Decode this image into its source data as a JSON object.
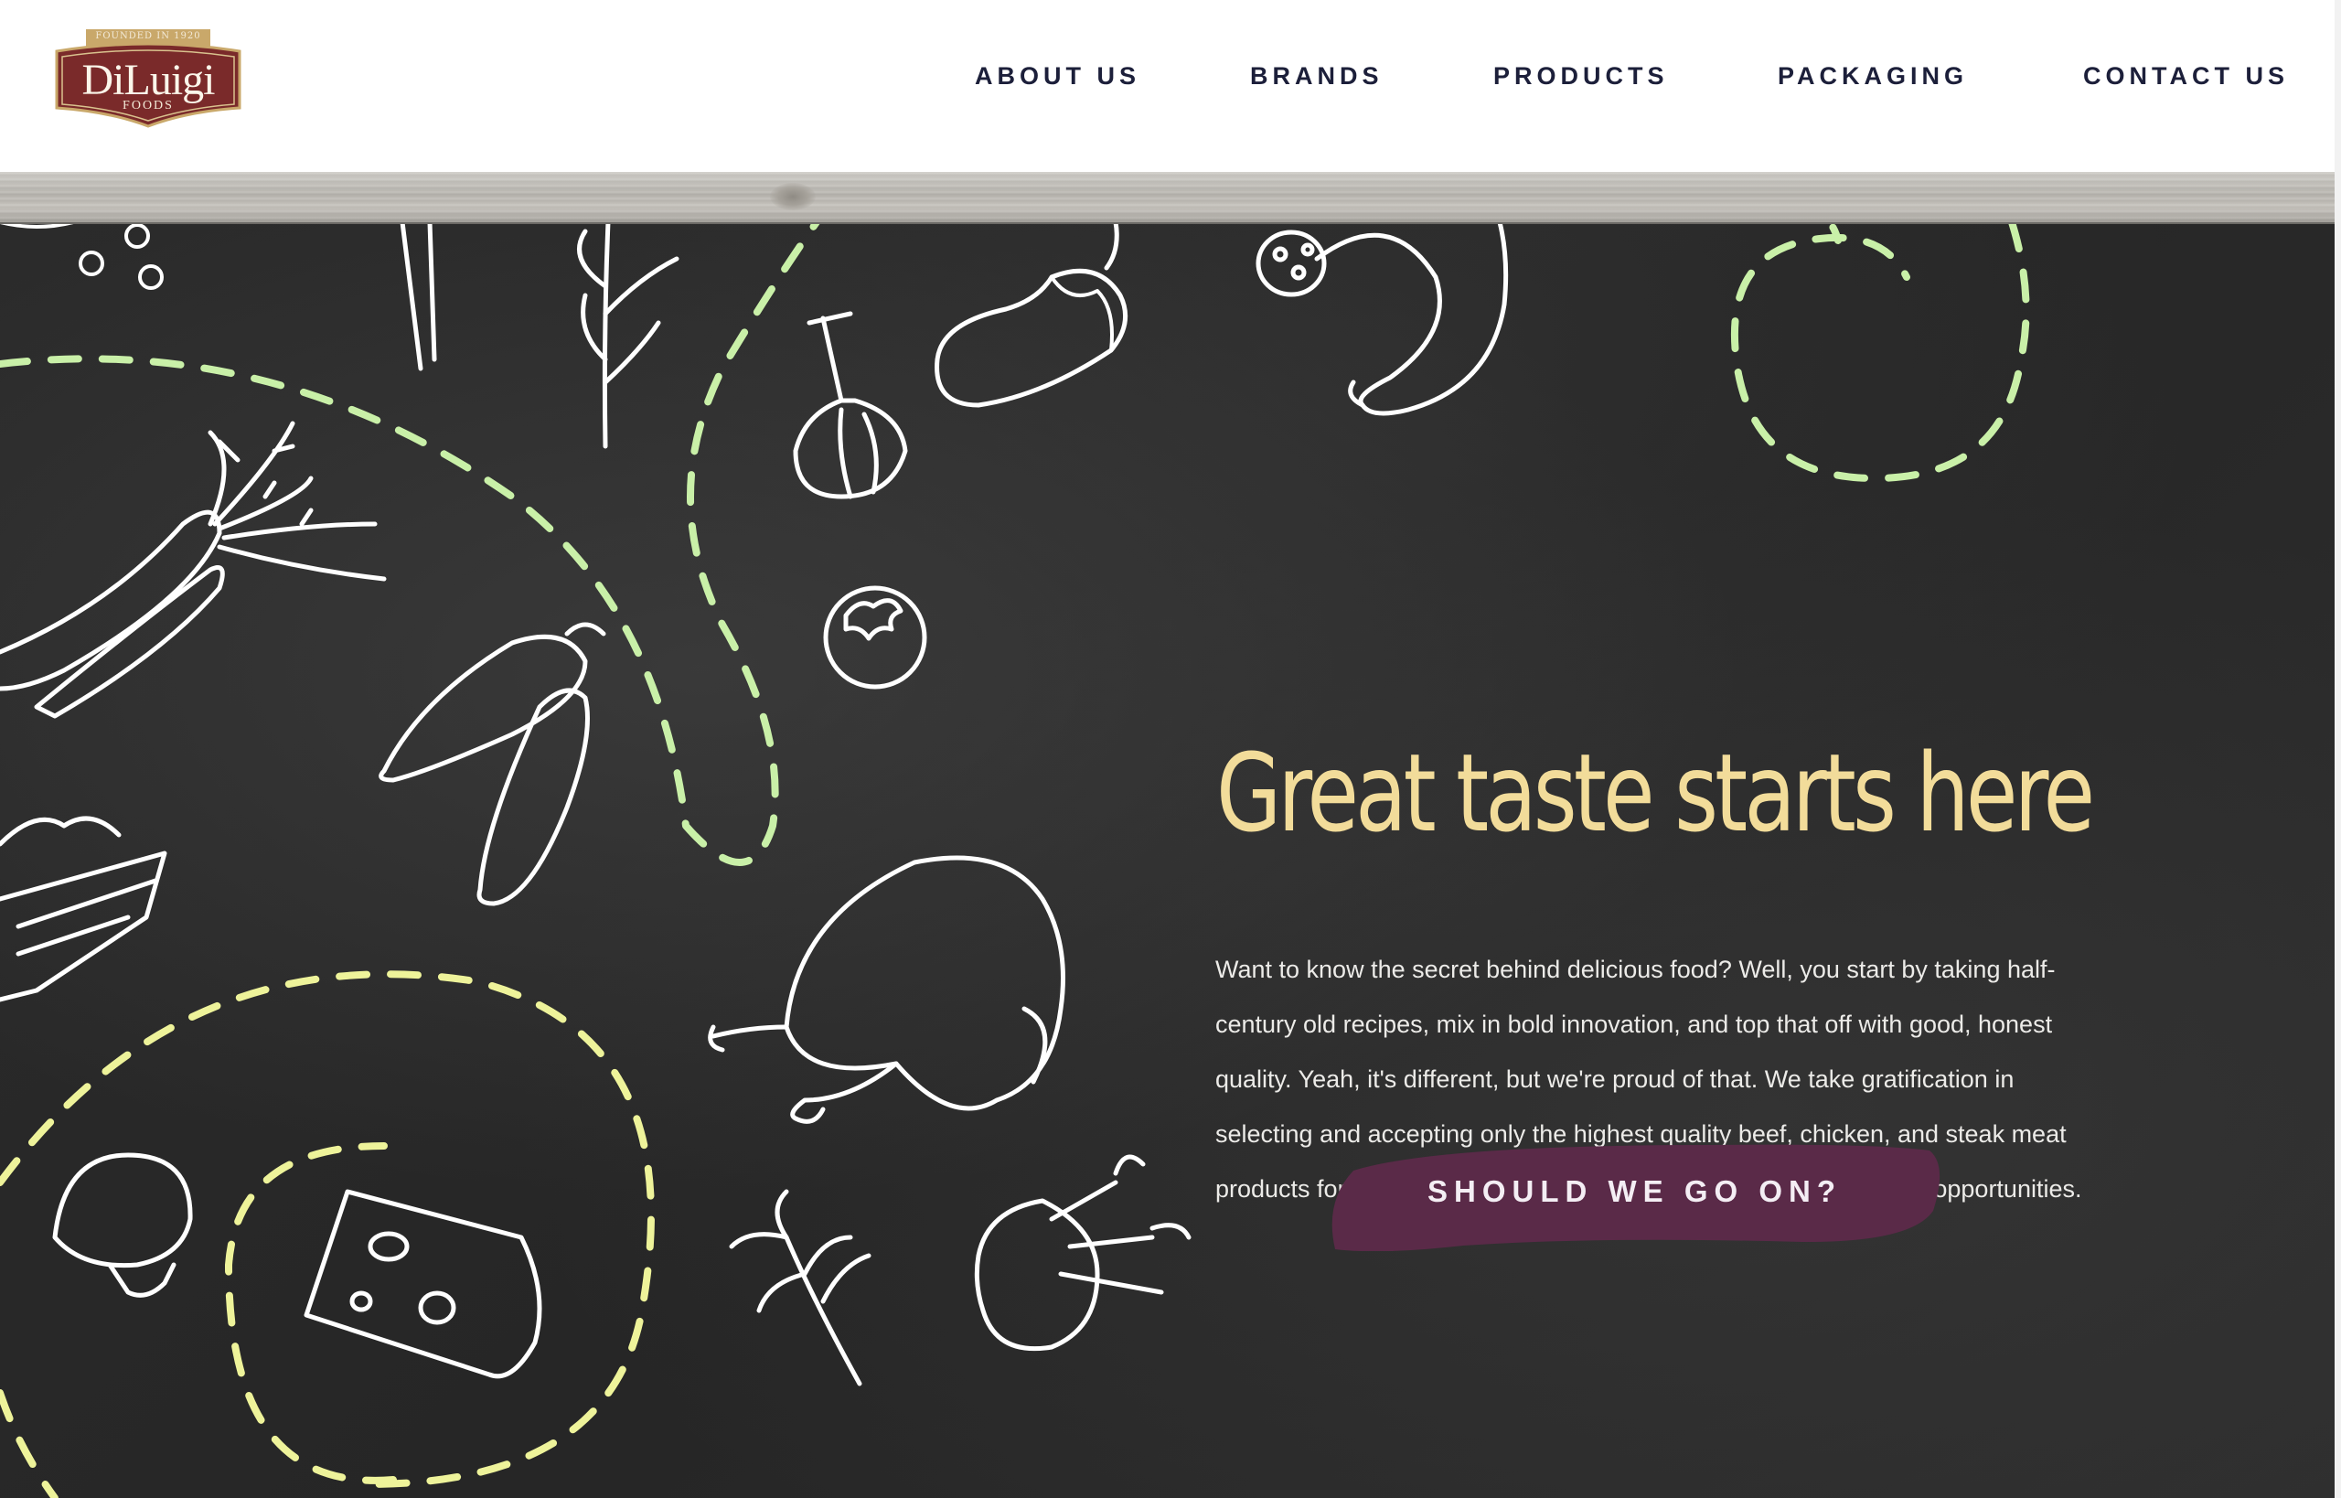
{
  "header": {
    "logo": {
      "founded": "FOUNDED IN 1920",
      "name": "DiLuigi",
      "tagline": "FOODS"
    },
    "nav": [
      {
        "label": "ABOUT US"
      },
      {
        "label": "BRANDS"
      },
      {
        "label": "PRODUCTS"
      },
      {
        "label": "PACKAGING"
      },
      {
        "label": "CONTACT US"
      }
    ]
  },
  "hero": {
    "headline": "Great taste starts here",
    "body": "Want to know the secret behind delicious food? Well, you start by taking half-century old recipes, mix in bold innovation, and top that off with good, honest quality. Yeah, it's different, but we're proud of that. We take gratification in selecting and accepting only the highest quality beef, chicken, and steak meat products for our customers. We offer various retail and wholesale opportunities.",
    "cta_label": "SHOULD WE GO ON?"
  },
  "colors": {
    "nav_text": "#1c1f3a",
    "logo_red": "#7a2a2a",
    "headline": "#f2dc9a",
    "cta_background": "#5a2a48",
    "chalkboard": "#2a2a2a",
    "dashes_green": "#c9f0a8",
    "dashes_yellow": "#eef39a"
  },
  "icons": [
    "carrot-icon",
    "cucumber-icon",
    "garlic-icon",
    "eggplant-icon",
    "sausage-icon",
    "tomato-icon",
    "chicken-icon",
    "egg-carton-icon",
    "mushroom-icon",
    "cheese-icon",
    "parsley-icon",
    "fennel-icon",
    "herb-sprig-icon"
  ]
}
